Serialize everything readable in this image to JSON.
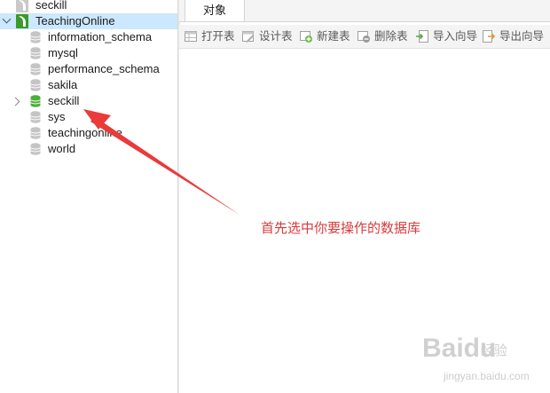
{
  "navigator": {
    "items": [
      {
        "label": "seckill",
        "type": "connection",
        "state": "closed"
      },
      {
        "label": "TeachingOnline",
        "type": "connection",
        "state": "open",
        "selected": true
      },
      {
        "label": "information_schema",
        "type": "database"
      },
      {
        "label": "mysql",
        "type": "database"
      },
      {
        "label": "performance_schema",
        "type": "database"
      },
      {
        "label": "sakila",
        "type": "database"
      },
      {
        "label": "seckill",
        "type": "database",
        "highlight": true
      },
      {
        "label": "sys",
        "type": "database"
      },
      {
        "label": "teachingonline",
        "type": "database"
      },
      {
        "label": "world",
        "type": "database"
      }
    ]
  },
  "tabs": {
    "active_label": "对象"
  },
  "toolbar": {
    "open_table": "打开表",
    "design_table": "设计表",
    "new_table": "新建表",
    "delete_table": "删除表",
    "import_wizard": "导入向导",
    "export_wizard": "导出向导"
  },
  "annotation": {
    "text": "首先选中你要操作的数据库",
    "color": "#d93b3b"
  },
  "watermark": {
    "logo": "Baidu",
    "sub": "经验",
    "url": "jingyan.baidu.com"
  },
  "colors": {
    "selection": "#cce8ff",
    "connection_green": "#3a9a2a",
    "active_db_green": "#4caf3a",
    "inactive_gray": "#b8b8b8"
  }
}
